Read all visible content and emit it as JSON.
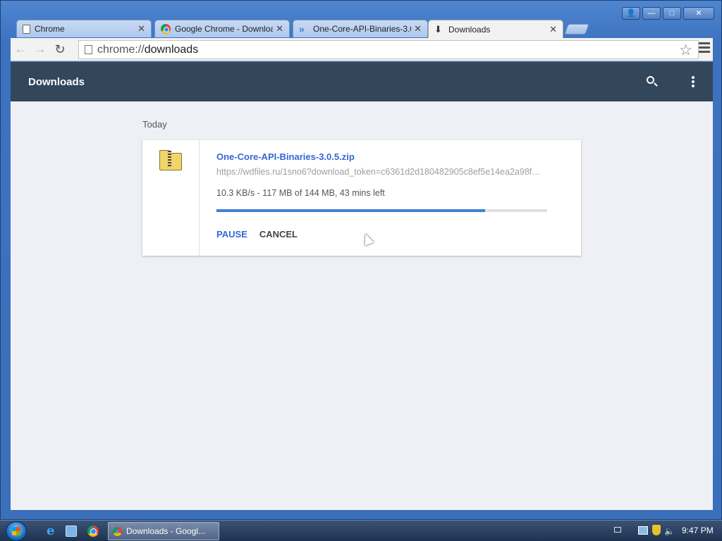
{
  "window": {
    "controls": {
      "user": "👤",
      "minimize": "—",
      "maximize": "□",
      "close": "✕"
    }
  },
  "tabs": [
    {
      "title": "Chrome",
      "icon": "page-icon",
      "active": false
    },
    {
      "title": "Google Chrome - Downloa",
      "icon": "chrome-logo-icon",
      "active": false
    },
    {
      "title": "One-Core-API-Binaries-3.0",
      "icon": "forward-chevron-icon",
      "active": false
    },
    {
      "title": "Downloads",
      "icon": "download-icon",
      "active": true
    }
  ],
  "tab_close_glyph": "✕",
  "toolbar": {
    "back": "←",
    "forward": "→",
    "reload": "↻",
    "url_scheme": "chrome://",
    "url_path": "downloads",
    "star": "☆"
  },
  "downloads_page": {
    "title": "Downloads",
    "date_heading": "Today",
    "items": [
      {
        "file_name": "One-Core-API-Binaries-3.0.5.zip",
        "url": "https://wdfiles.ru/1sno6?download_token=c6361d2d180482905c8ef5e14ea2a98f…",
        "status": "10.3 KB/s - 117 MB of 144 MB, 43 mins left",
        "progress_fraction": 0.813,
        "actions": {
          "pause": "PAUSE",
          "cancel": "CANCEL"
        },
        "icon": "zip-folder-icon"
      }
    ]
  },
  "taskbar": {
    "active_task": "Downloads - Googl...",
    "clock": "9:47 PM"
  },
  "colors": {
    "header": "#33475b",
    "link": "#3367d6",
    "progress": "#3f7fd8",
    "page_bg": "#eef0f5"
  }
}
